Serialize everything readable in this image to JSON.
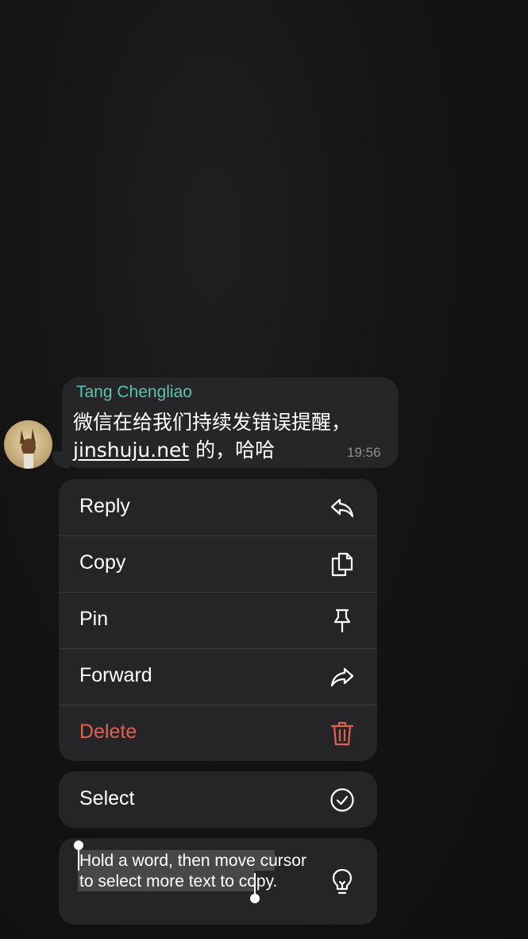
{
  "message": {
    "sender": "Tang Chengliao",
    "line1": "微信在给我们持续发错误提醒，",
    "link": "jinshuju.net",
    "line2_suffix": " 的，哈哈",
    "time": "19:56"
  },
  "menu": {
    "items": [
      {
        "label": "Reply",
        "icon": "reply-icon"
      },
      {
        "label": "Copy",
        "icon": "copy-icon"
      },
      {
        "label": "Pin",
        "icon": "pin-icon"
      },
      {
        "label": "Forward",
        "icon": "forward-icon"
      },
      {
        "label": "Delete",
        "icon": "trash-icon"
      }
    ],
    "select": {
      "label": "Select",
      "icon": "checkmark-circle-icon"
    }
  },
  "tip": {
    "text": "Hold a word, then move cursor to select more text to copy.",
    "icon": "lightbulb-icon"
  },
  "colors": {
    "sender": "#5bc4b4",
    "danger": "#e0614f"
  }
}
